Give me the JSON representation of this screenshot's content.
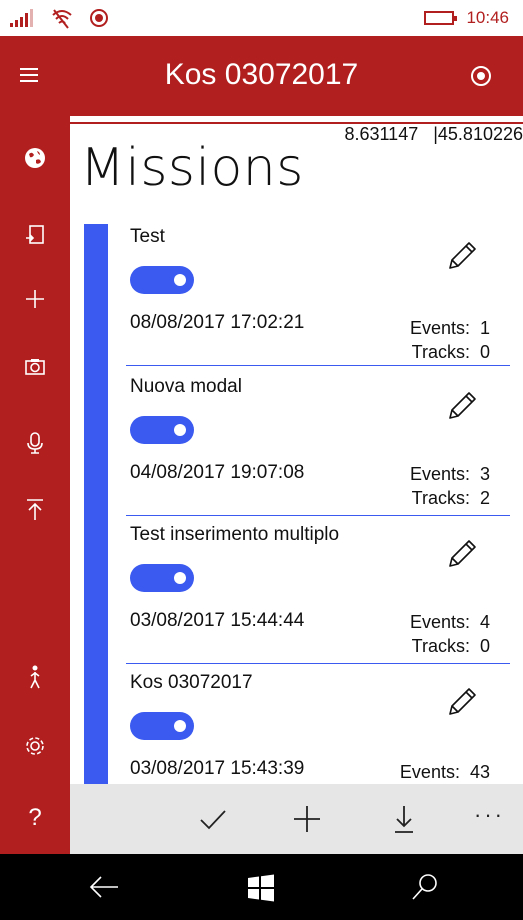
{
  "status": {
    "time": "10:46"
  },
  "header": {
    "title": "Kos 03072017"
  },
  "coords": {
    "lon": "8.631147",
    "lat": "45.810226"
  },
  "page": {
    "heading": "Missions"
  },
  "missions": [
    {
      "name": "Test",
      "date": "08/08/2017 17:02:21",
      "events_label": "Events:",
      "events": "1",
      "tracks_label": "Tracks:",
      "tracks": "0",
      "enabled": true
    },
    {
      "name": "Nuova modal",
      "date": "04/08/2017 19:07:08",
      "events_label": "Events:",
      "events": "3",
      "tracks_label": "Tracks:",
      "tracks": "2",
      "enabled": true
    },
    {
      "name": "Test inserimento multiplo",
      "date": "03/08/2017 15:44:44",
      "events_label": "Events:",
      "events": "4",
      "tracks_label": "Tracks:",
      "tracks": "0",
      "enabled": true
    },
    {
      "name": "Kos 03072017",
      "date": "03/08/2017 15:43:39",
      "events_label": "Events:",
      "events": "43",
      "enabled": true
    }
  ],
  "sidebar_icons": [
    "globe-icon",
    "import-icon",
    "add-icon",
    "camera-icon",
    "microphone-icon",
    "upload-icon",
    "hiker-icon",
    "settings-icon",
    "help-icon"
  ],
  "bottom_bar": {
    "icons": [
      "check-icon",
      "add-icon",
      "download-icon",
      "more-icon"
    ],
    "more": "···"
  },
  "colors": {
    "primary": "#b21f1f",
    "accent": "#3b5bf0",
    "bar": "#e6e6e6"
  }
}
